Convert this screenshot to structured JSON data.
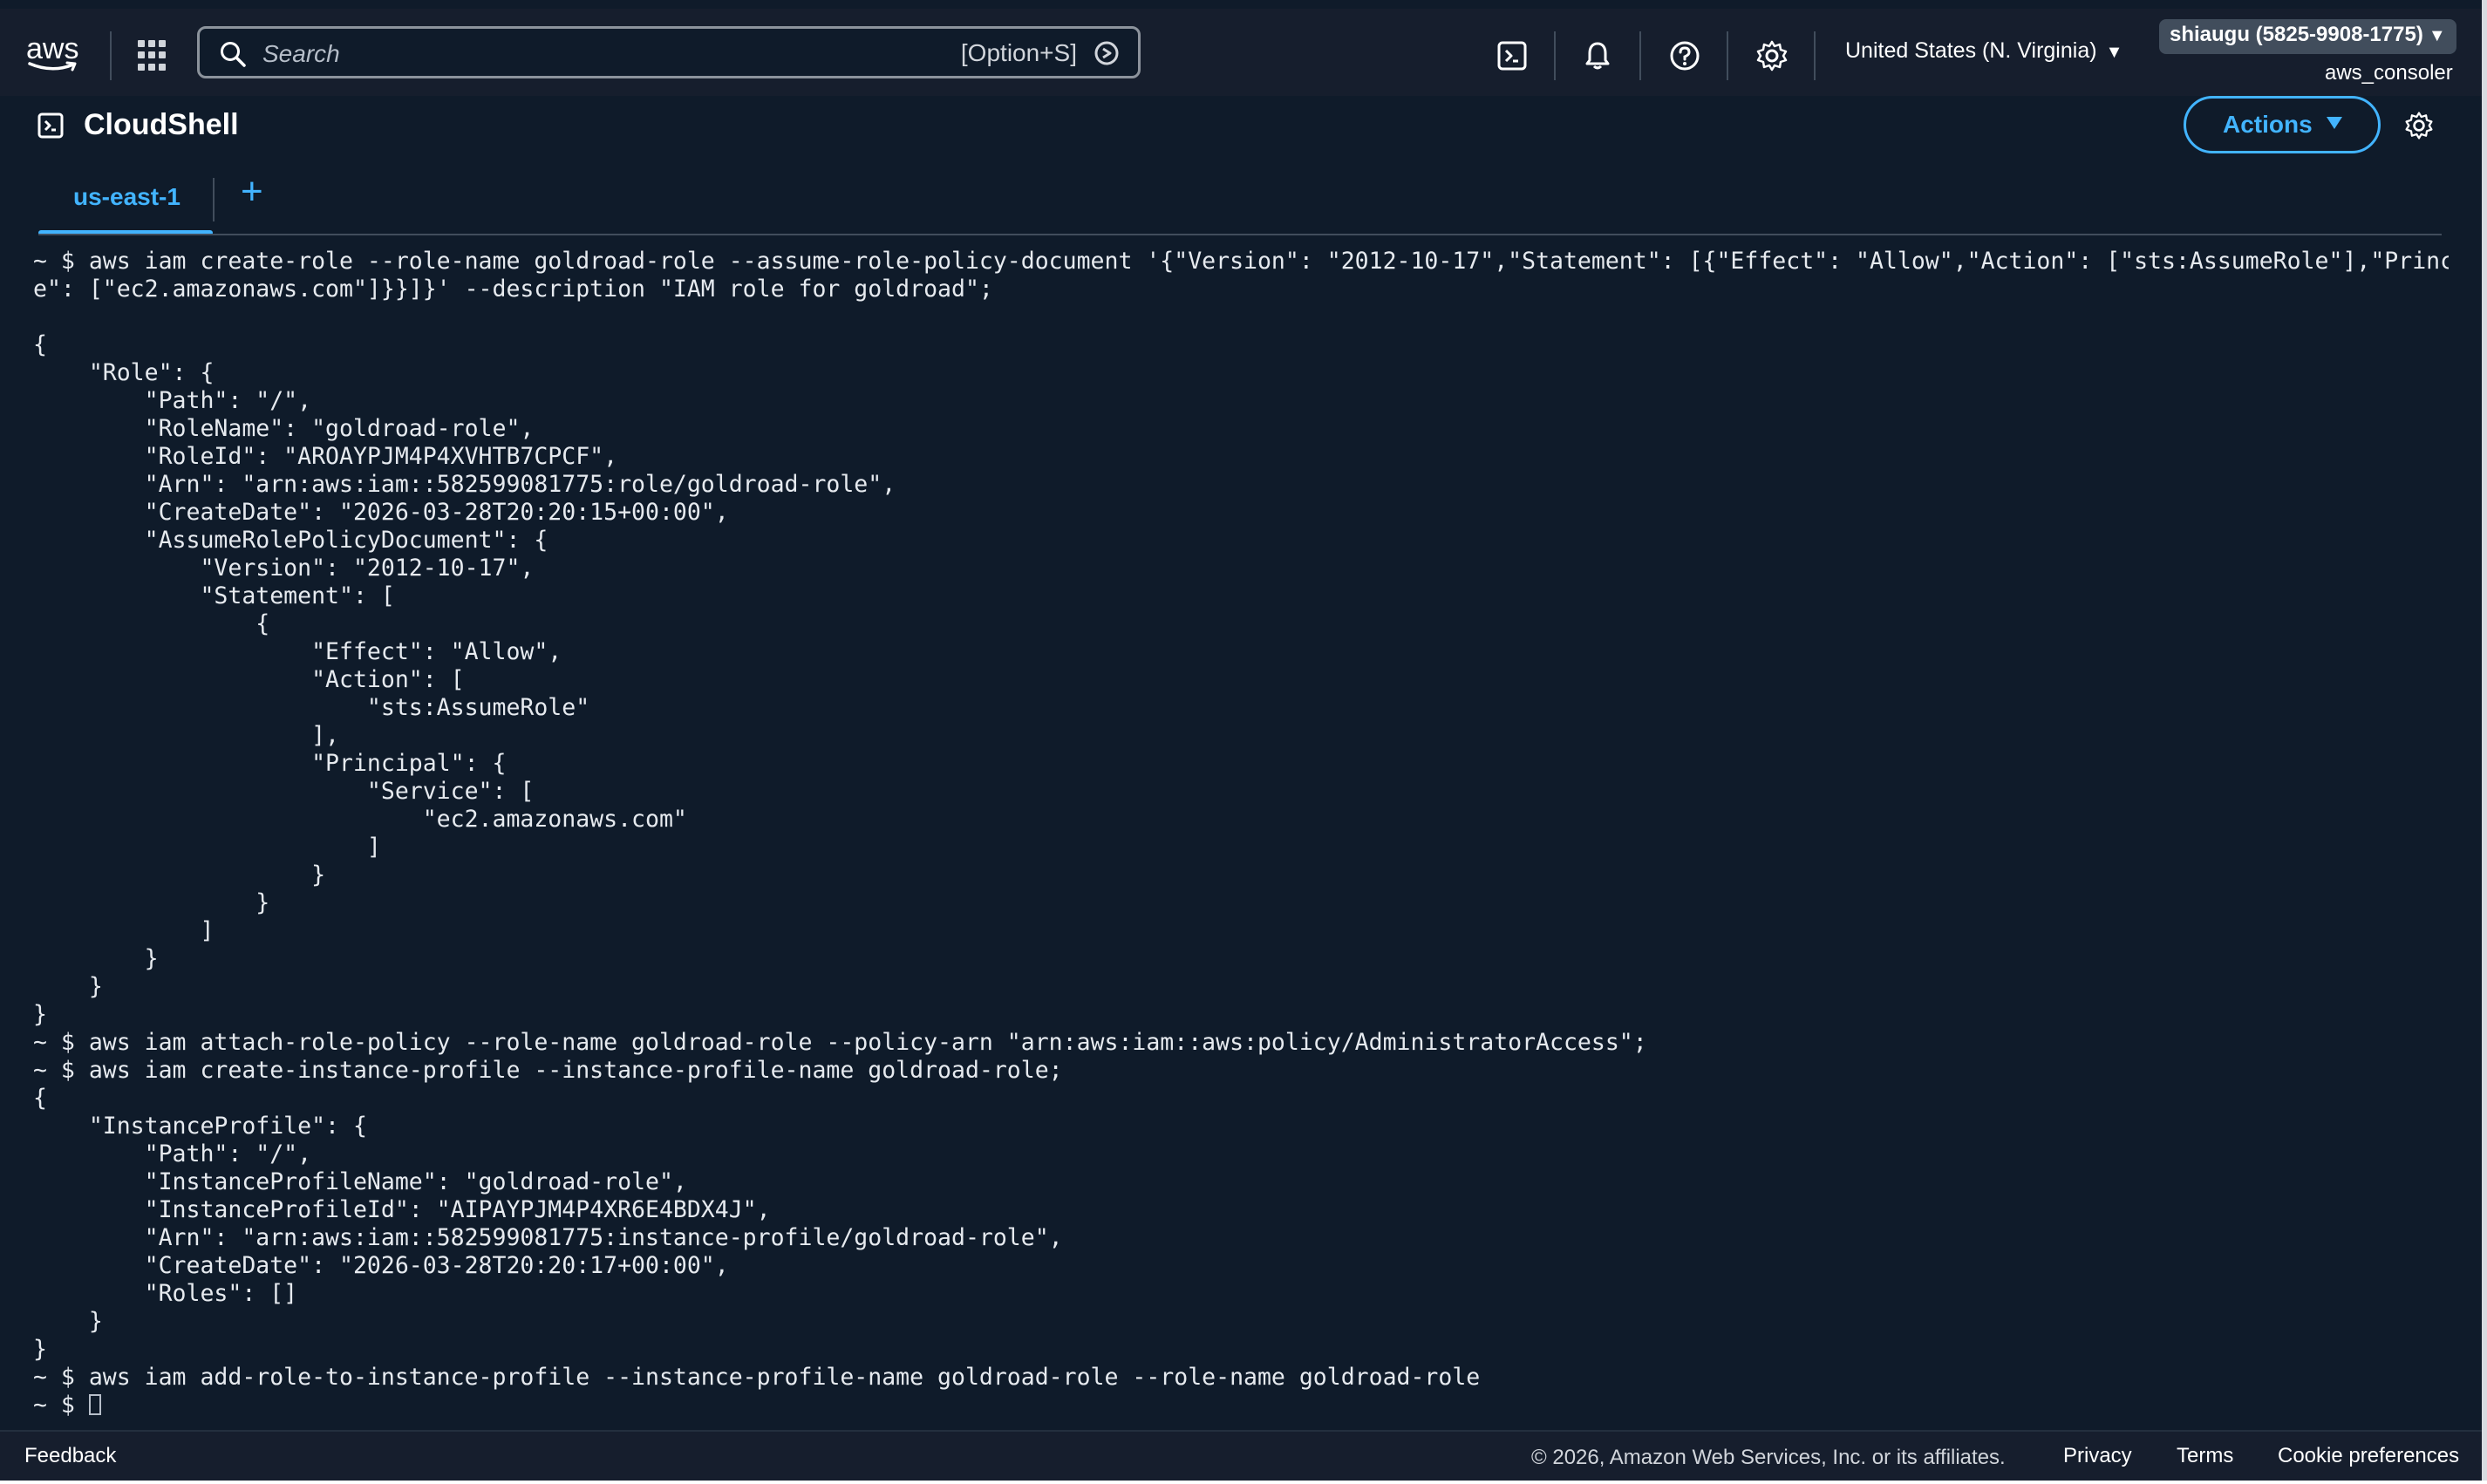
{
  "nav": {
    "logo_text": "aws",
    "search_placeholder": "Search",
    "search_shortcut": "[Option+S]",
    "region": "United States (N. Virginia)",
    "account": "shiaugu (5825-9908-1775)",
    "role": "aws_consoler"
  },
  "header": {
    "title": "CloudShell",
    "actions_label": "Actions"
  },
  "tabs": [
    {
      "label": "us-east-1",
      "active": true
    }
  ],
  "tab_add_label": "+",
  "terminal": {
    "lines": [
      "~ $ aws iam create-role --role-name goldroad-role --assume-role-policy-document '{\"Version\": \"2012-10-17\",\"Statement\": [{\"Effect\": \"Allow\",\"Action\": [\"sts:AssumeRole\"],\"Principal\": {\"Servic",
      "e\": [\"ec2.amazonaws.com\"]}}]}' --description \"IAM role for goldroad\";",
      "",
      "{",
      "    \"Role\": {",
      "        \"Path\": \"/\",",
      "        \"RoleName\": \"goldroad-role\",",
      "        \"RoleId\": \"AROAYPJM4P4XVHTB7CPCF\",",
      "        \"Arn\": \"arn:aws:iam::582599081775:role/goldroad-role\",",
      "        \"CreateDate\": \"2026-03-28T20:20:15+00:00\",",
      "        \"AssumeRolePolicyDocument\": {",
      "            \"Version\": \"2012-10-17\",",
      "            \"Statement\": [",
      "                {",
      "                    \"Effect\": \"Allow\",",
      "                    \"Action\": [",
      "                        \"sts:AssumeRole\"",
      "                    ],",
      "                    \"Principal\": {",
      "                        \"Service\": [",
      "                            \"ec2.amazonaws.com\"",
      "                        ]",
      "                    }",
      "                }",
      "            ]",
      "        }",
      "    }",
      "}",
      "~ $ aws iam attach-role-policy --role-name goldroad-role --policy-arn \"arn:aws:iam::aws:policy/AdministratorAccess\";",
      "~ $ aws iam create-instance-profile --instance-profile-name goldroad-role;",
      "{",
      "    \"InstanceProfile\": {",
      "        \"Path\": \"/\",",
      "        \"InstanceProfileName\": \"goldroad-role\",",
      "        \"InstanceProfileId\": \"AIPAYPJM4P4XR6E4BDX4J\",",
      "        \"Arn\": \"arn:aws:iam::582599081775:instance-profile/goldroad-role\",",
      "        \"CreateDate\": \"2026-03-28T20:20:17+00:00\",",
      "        \"Roles\": []",
      "    }",
      "}",
      "~ $ aws iam add-role-to-instance-profile --instance-profile-name goldroad-role --role-name goldroad-role"
    ],
    "prompt": "~ $ "
  },
  "footer": {
    "feedback": "Feedback",
    "copyright": "© 2026, Amazon Web Services, Inc. or its affiliates.",
    "privacy": "Privacy",
    "terms": "Terms",
    "cookies": "Cookie preferences"
  },
  "icons": {
    "search": "search-icon",
    "cloudshell": "cloudshell-icon",
    "notifications": "bell-icon",
    "help": "help-icon",
    "settings": "gear-icon",
    "apps": "apps-grid-icon"
  },
  "colors": {
    "background": "#0f1b2a",
    "nav": "#161e2d",
    "accent": "#42b4ff",
    "text": "#e6eaef"
  }
}
